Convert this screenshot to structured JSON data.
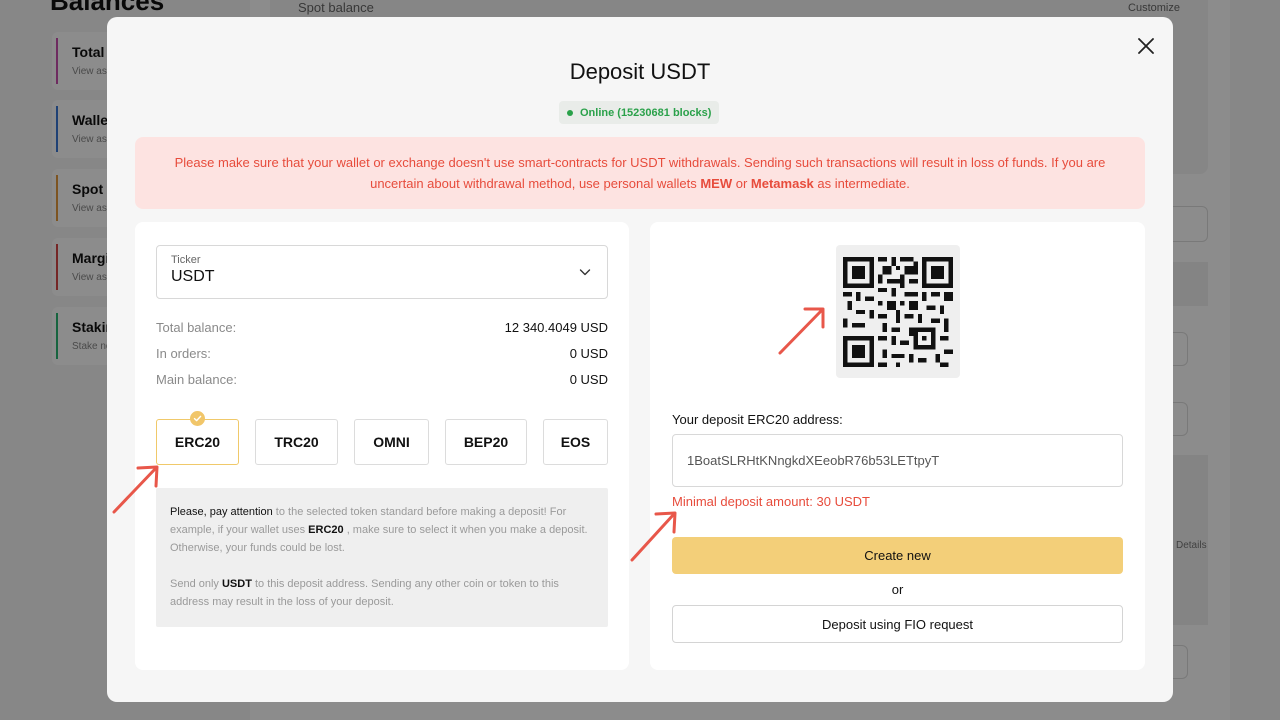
{
  "background": {
    "heading": "Balances",
    "nav": [
      {
        "title": "Total",
        "sub": "View assets"
      },
      {
        "title": "Wallet",
        "sub": "View assets"
      },
      {
        "title": "Spot",
        "sub": "View assets"
      },
      {
        "title": "Margin",
        "sub": "View assets"
      },
      {
        "title": "Staking",
        "sub": "Stake now"
      }
    ],
    "nav_colors": [
      "#c94fb0",
      "#3a77d6",
      "#e39a3c",
      "#d64545",
      "#2bb673"
    ],
    "spot_balance_label": "Spot balance",
    "customize_label": "Customize",
    "details_label": "Details"
  },
  "modal": {
    "title": "Deposit USDT",
    "status": "Online (15230681 blocks)",
    "warning_text_1": "Please make sure that your wallet or exchange doesn't use smart-contracts for USDT withdrawals. Sending such transactions will result in loss of funds. If you are uncertain about withdrawal method, use personal wallets ",
    "warning_mew": "MEW",
    "warning_or": " or ",
    "warning_metamask": "Metamask",
    "warning_tail": " as intermediate.",
    "ticker": {
      "label": "Ticker",
      "value": "USDT"
    },
    "balances": [
      {
        "label": "Total balance:",
        "value": "12 340.4049 USD"
      },
      {
        "label": "In orders:",
        "value": "0 USD"
      },
      {
        "label": "Main balance:",
        "value": "0 USD"
      }
    ],
    "standards": [
      "ERC20",
      "TRC20",
      "OMNI",
      "BEP20",
      "EOS"
    ],
    "selected_standard": "ERC20",
    "note": {
      "p1_a": "Please, pay attention",
      "p1_b": " to the selected token standard before making a deposit! For example, if your wallet uses ",
      "p1_c": "ERC20",
      "p1_d": " , make sure to select it when you make a deposit. Otherwise, your funds could be lost.",
      "p2_a": "Send only ",
      "p2_b": "USDT",
      "p2_c": " to this deposit address. Sending any other coin or token to this address may result in the loss of your deposit."
    },
    "address_label": "Your deposit ERC20 address:",
    "address": "1BoatSLRHtKNngkdXEeobR76b53LETtpyT",
    "min_deposit": "Minimal deposit amount: 30 USDT",
    "create_new": "Create new",
    "or": "or",
    "fio_button": "Deposit using FIO request"
  },
  "colors": {
    "accent_yellow": "#f3cf79",
    "warning_red": "#e74c3c",
    "online_green": "#2aa14a",
    "annotation_arrow": "#e8574a"
  }
}
